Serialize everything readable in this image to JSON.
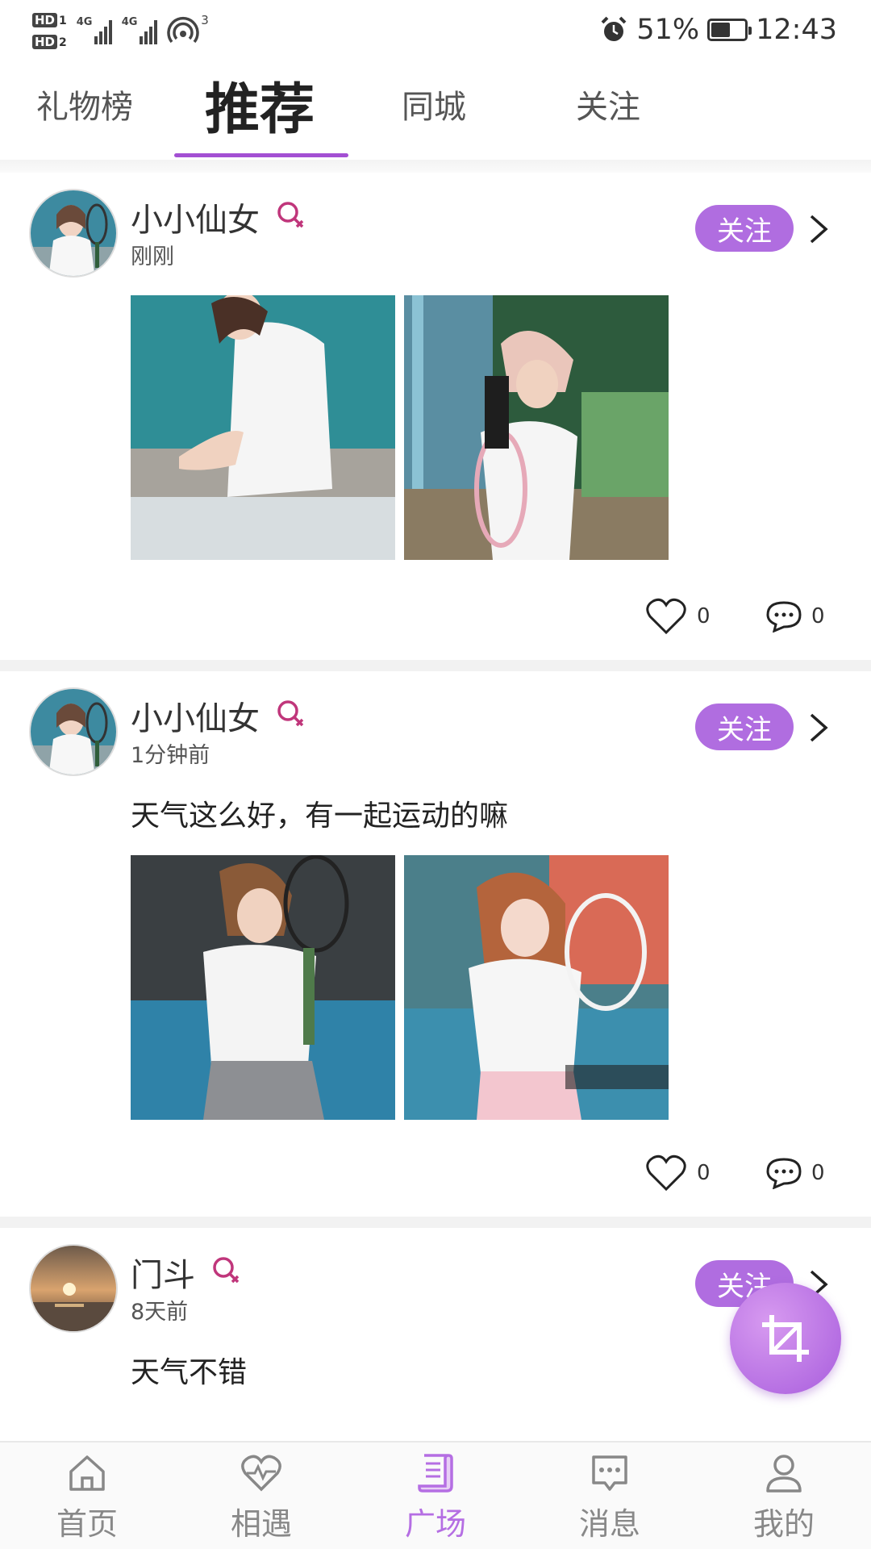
{
  "status_bar": {
    "hd1": "HD",
    "hd1_num": "1",
    "hd2": "HD",
    "hd2_num": "2",
    "net1": "4G",
    "net2": "4G",
    "hotspot_count": "3",
    "battery_percent": "51%",
    "battery_level": 0.51,
    "time": "12:43"
  },
  "tabs": [
    {
      "label": "礼物榜",
      "active": false
    },
    {
      "label": "推荐",
      "active": true
    },
    {
      "label": "同城",
      "active": false
    },
    {
      "label": "关注",
      "active": false
    }
  ],
  "accent_color": "#a34fd3",
  "posts": [
    {
      "username": "小小仙女",
      "time": "刚刚",
      "text": "",
      "follow_label": "关注",
      "likes": "0",
      "comments": "0"
    },
    {
      "username": "小小仙女",
      "time": "1分钟前",
      "text": "天气这么好，有一起运动的嘛",
      "follow_label": "关注",
      "likes": "0",
      "comments": "0"
    },
    {
      "username": "门斗",
      "time": "8天前",
      "text": "天气不错",
      "follow_label": "关注"
    }
  ],
  "fab": {
    "icon": "crop-icon"
  },
  "bottom_nav": [
    {
      "label": "首页",
      "icon": "home-icon",
      "active": false
    },
    {
      "label": "相遇",
      "icon": "heart-pulse-icon",
      "active": false
    },
    {
      "label": "广场",
      "icon": "scroll-icon",
      "active": true
    },
    {
      "label": "消息",
      "icon": "chat-icon",
      "active": false
    },
    {
      "label": "我的",
      "icon": "user-icon",
      "active": false
    }
  ]
}
